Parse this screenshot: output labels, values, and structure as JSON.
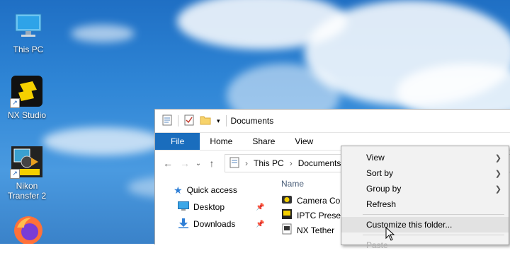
{
  "desktop": {
    "icons": [
      {
        "label": "This PC",
        "icon": "monitor-icon"
      },
      {
        "label": "NX Studio",
        "icon": "nx-studio-icon"
      },
      {
        "label": "Nikon Transfer 2",
        "icon": "nikon-transfer-icon"
      },
      {
        "label": "",
        "icon": "firefox-icon"
      }
    ]
  },
  "explorer": {
    "title": "Documents",
    "ribbon_tabs": [
      "File",
      "Home",
      "Share",
      "View"
    ],
    "breadcrumb": [
      "This PC",
      "Documents"
    ],
    "nav_items": [
      {
        "label": "Quick access",
        "icon": "star-icon"
      },
      {
        "label": "Desktop",
        "icon": "desktop-icon",
        "pinned": true
      },
      {
        "label": "Downloads",
        "icon": "download-icon",
        "pinned": true
      }
    ],
    "column_name": "Name",
    "files": [
      "Camera Control",
      "IPTC Preset Manager",
      "NX Tether"
    ]
  },
  "context_menu": {
    "items": [
      {
        "label": "View",
        "submenu": true
      },
      {
        "label": "Sort by",
        "submenu": true
      },
      {
        "label": "Group by",
        "submenu": true
      },
      {
        "label": "Refresh",
        "submenu": false
      },
      {
        "label": "Customize this folder...",
        "submenu": false
      },
      {
        "label": "Paste",
        "submenu": false
      }
    ]
  },
  "colors": {
    "accent": "#1a6dbd",
    "sky": "#2f86d6"
  }
}
